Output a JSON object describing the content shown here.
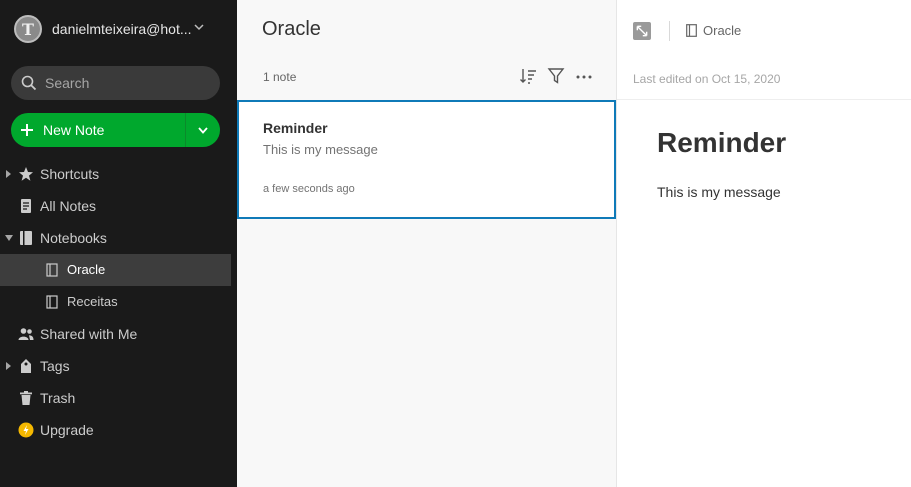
{
  "account": {
    "avatar_letter": "T",
    "name": "danielmteixeira@hot..."
  },
  "search": {
    "placeholder": "Search"
  },
  "new_note": {
    "label": "New Note"
  },
  "nav": {
    "shortcuts": "Shortcuts",
    "all_notes": "All Notes",
    "notebooks": "Notebooks",
    "notebook_items": [
      "Oracle",
      "Receitas"
    ],
    "shared": "Shared with Me",
    "tags": "Tags",
    "trash": "Trash",
    "upgrade": "Upgrade"
  },
  "list": {
    "title": "Oracle",
    "count": "1 note",
    "notes": [
      {
        "title": "Reminder",
        "snippet": "This is my message",
        "time": "a few seconds ago"
      }
    ]
  },
  "editor": {
    "notebook": "Oracle",
    "last_edited": "Last edited on Oct 15, 2020",
    "title": "Reminder",
    "body": "This is my message"
  },
  "colors": {
    "accent_green": "#00a82d",
    "selection_blue": "#0f7ab8",
    "upgrade_yellow": "#f5b800"
  }
}
